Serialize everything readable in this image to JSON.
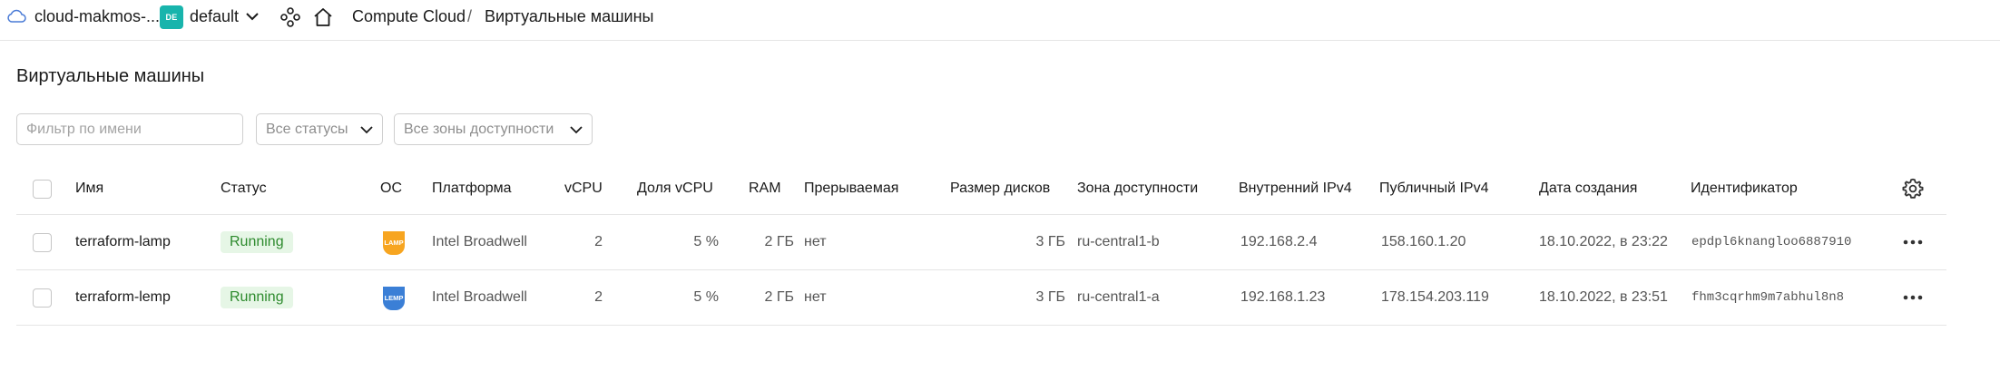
{
  "header": {
    "cloud_name": "cloud-makmos-...",
    "folder_badge": "DE",
    "folder_name": "default",
    "breadcrumb": {
      "service": "Compute Cloud",
      "separator": "/",
      "current": "Виртуальные машины"
    },
    "icons": [
      "cloud-icon",
      "chevron-down-icon",
      "services-icon",
      "home-icon"
    ]
  },
  "page": {
    "title": "Виртуальные машины"
  },
  "filters": {
    "name_placeholder": "Фильтр по имени",
    "status_value": "Все статусы",
    "zone_value": "Все зоны доступности"
  },
  "table": {
    "columns": {
      "name": "Имя",
      "status": "Статус",
      "os": "ОС",
      "platform": "Платформа",
      "vcpu": "vCPU",
      "vcpu_share": "Доля vCPU",
      "ram": "RAM",
      "preemptible": "Прерываемая",
      "disk_size": "Размер дисков",
      "zone": "Зона доступности",
      "internal_ip": "Внутренний IPv4",
      "public_ip": "Публичный IPv4",
      "created": "Дата создания",
      "id": "Идентификатор"
    },
    "rows": [
      {
        "name": "terraform-lamp",
        "status": "Running",
        "os_label": "LAMP",
        "platform": "Intel Broadwell",
        "vcpu": "2",
        "vcpu_share": "5 %",
        "ram": "2 ГБ",
        "preemptible": "нет",
        "disk_size": "3 ГБ",
        "zone": "ru-central1-b",
        "internal_ip": "192.168.2.4",
        "public_ip": "158.160.1.20",
        "created": "18.10.2022, в 23:22",
        "id": "epdpl6knangloo6887910"
      },
      {
        "name": "terraform-lemp",
        "status": "Running",
        "os_label": "LEMP",
        "platform": "Intel Broadwell",
        "vcpu": "2",
        "vcpu_share": "5 %",
        "ram": "2 ГБ",
        "preemptible": "нет",
        "disk_size": "3 ГБ",
        "zone": "ru-central1-a",
        "internal_ip": "192.168.1.23",
        "public_ip": "178.154.203.119",
        "created": "18.10.2022, в 23:51",
        "id": "fhm3cqrhm9m7abhul8n8"
      }
    ]
  },
  "colors": {
    "folder_badge": "#18b4ac",
    "running_bg": "#e6f6e6",
    "running_text": "#2d8a2d",
    "lamp_icon": "#f7a520",
    "lemp_icon": "#3b7fd6"
  }
}
